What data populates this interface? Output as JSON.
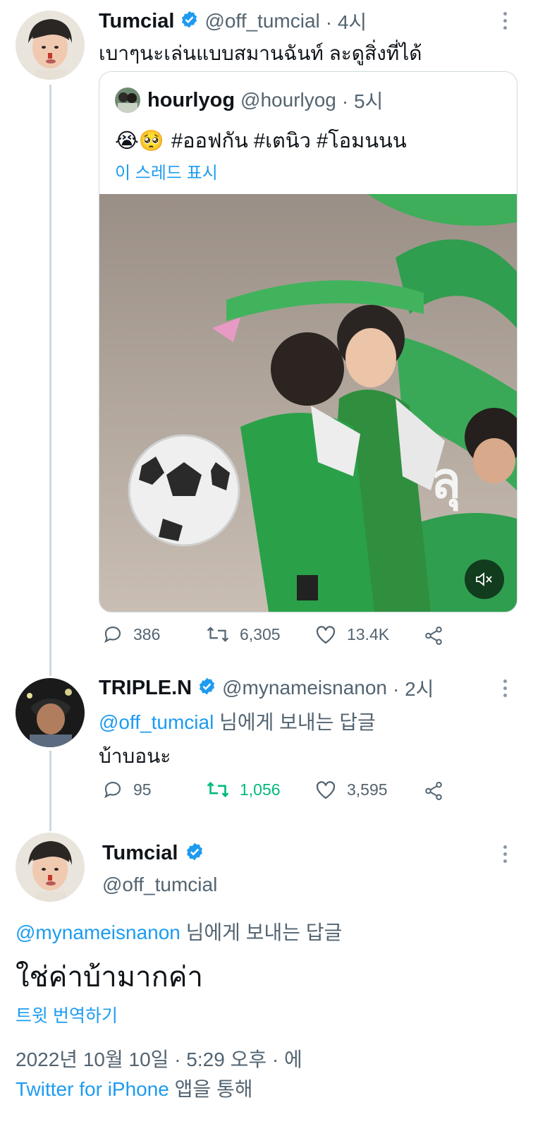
{
  "tweet1": {
    "name": "Tumcial",
    "handle": "@off_tumcial",
    "time": "· 4시",
    "text": "เบาๆนะเล่นแบบสมานฉันท์ ละดูสิ่งที่ได้"
  },
  "quote": {
    "name": "hourlyog",
    "handle": "@hourlyog",
    "time": "· 5시",
    "emoji": "😭🥺",
    "hashtags": "#ออฟกัน #เตนิว #โอมนนน",
    "show_thread": "이 스레드 표시",
    "mute_icon": "speaker-mute-icon"
  },
  "tweet1_stats": {
    "replies": "386",
    "retweets": "6,305",
    "likes": "13.4K"
  },
  "tweet2": {
    "name": "TRIPLE.N",
    "handle": "@mynameisnanon",
    "time": "· 2시",
    "reply_to_handle": "@off_tumcial",
    "reply_to_suffix": " 님에게 보내는 답글",
    "text": "บ้าบอนะ"
  },
  "tweet2_stats": {
    "replies": "95",
    "retweets": "1,056",
    "likes": "3,595"
  },
  "main": {
    "name": "Tumcial",
    "handle": "@off_tumcial",
    "reply_to_handle": "@mynameisnanon",
    "reply_to_suffix": " 님에게 보내는 답글",
    "text": "ใช่ค่าบ้ามากค่า",
    "translate": "트윗 번역하기",
    "datetime": "2022년 10월 10일 · 5:29 오후 · 에",
    "source": "Twitter for iPhone",
    "source_suffix": " 앱을 통해"
  },
  "colors": {
    "accent": "#1d9bf0",
    "retweet_green": "#00ba7c",
    "muted": "#536471"
  }
}
